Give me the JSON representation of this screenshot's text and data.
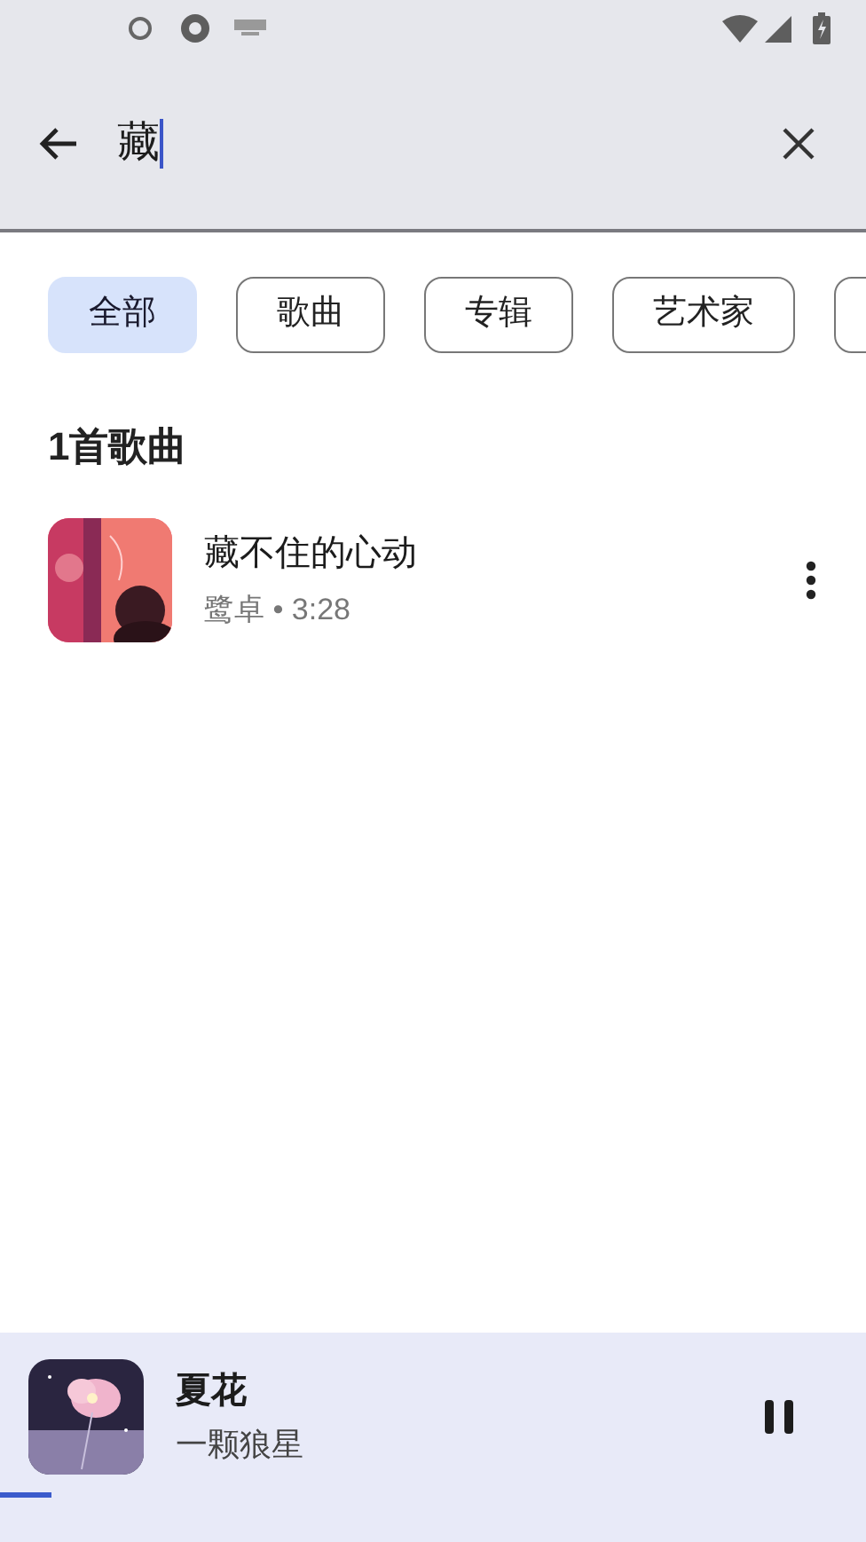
{
  "search": {
    "value": "藏"
  },
  "filters": [
    {
      "label": "全部",
      "selected": true
    },
    {
      "label": "歌曲",
      "selected": false
    },
    {
      "label": "专辑",
      "selected": false
    },
    {
      "label": "艺术家",
      "selected": false
    }
  ],
  "results": {
    "heading": "1首歌曲",
    "songs": [
      {
        "title": "藏不住的心动",
        "subtitle": "鹭卓 • 3:28"
      }
    ]
  },
  "now_playing": {
    "title": "夏花",
    "artist": "一颗狼星",
    "playing": true,
    "level": 0.06
  }
}
